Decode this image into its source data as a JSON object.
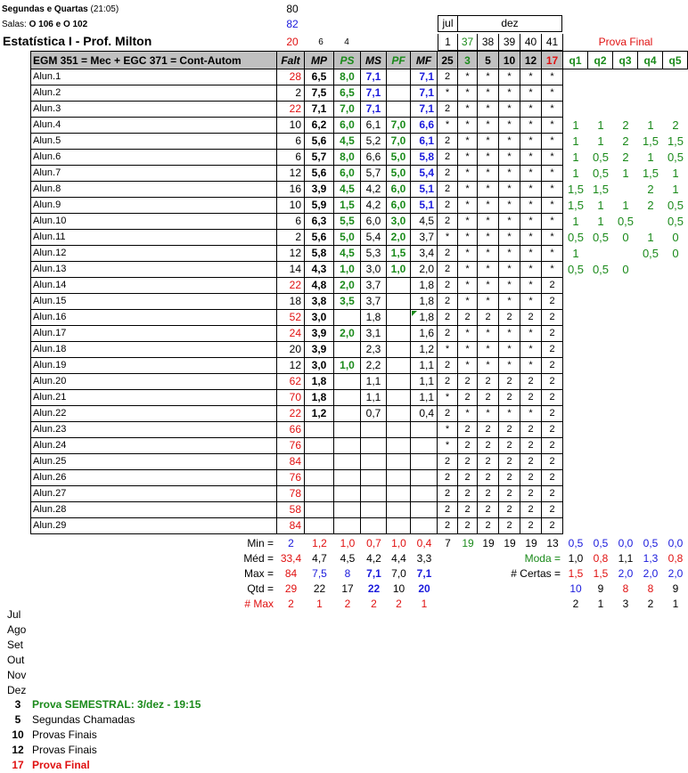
{
  "header": {
    "schedule_line": "Segundas e Quartas",
    "schedule_time": "(21:05)",
    "rooms_label": "Salas:",
    "rooms_value": "O 106 e O 102",
    "title": "Estatística I - Prof. Milton",
    "total_classes": "80",
    "classes_given": "82",
    "absence_limit": "20",
    "weight_mp": "6",
    "weight_ps": "4",
    "month_jul": "jul",
    "month_dez": "dez",
    "day_numbers": [
      "1",
      "37",
      "38",
      "39",
      "40",
      "41"
    ],
    "prova_final_label": "Prova Final",
    "course_label": "EGM 351 = Mec + EGC 371 = Cont-Autom",
    "columns": [
      "Falt",
      "MP",
      "PS",
      "MS",
      "PF",
      "MF",
      "25",
      "3",
      "5",
      "10",
      "12",
      "17",
      "q1",
      "q2",
      "q3",
      "q4",
      "q5"
    ]
  },
  "colors": {
    "red": "#e01010",
    "blue": "#1a1adc",
    "green": "#1a8a1a",
    "header_bg": "#c0c0c0"
  },
  "students": [
    [
      "Alun.1",
      "28",
      "6,5",
      "8,0",
      "7,1",
      "",
      "7,1",
      "2",
      "*",
      "*",
      "*",
      "*",
      "*",
      "",
      "",
      "",
      "",
      ""
    ],
    [
      "Alun.2",
      "2",
      "7,5",
      "6,5",
      "7,1",
      "",
      "7,1",
      "*",
      "*",
      "*",
      "*",
      "*",
      "*",
      "",
      "",
      "",
      "",
      ""
    ],
    [
      "Alun.3",
      "22",
      "7,1",
      "7,0",
      "7,1",
      "",
      "7,1",
      "2",
      "*",
      "*",
      "*",
      "*",
      "*",
      "",
      "",
      "",
      "",
      ""
    ],
    [
      "Alun.4",
      "10",
      "6,2",
      "6,0",
      "6,1",
      "7,0",
      "6,6",
      "*",
      "*",
      "*",
      "*",
      "*",
      "*",
      "1",
      "1",
      "2",
      "1",
      "2"
    ],
    [
      "Alun.5",
      "6",
      "5,6",
      "4,5",
      "5,2",
      "7,0",
      "6,1",
      "2",
      "*",
      "*",
      "*",
      "*",
      "*",
      "1",
      "1",
      "2",
      "1,5",
      "1,5"
    ],
    [
      "Alun.6",
      "6",
      "5,7",
      "8,0",
      "6,6",
      "5,0",
      "5,8",
      "2",
      "*",
      "*",
      "*",
      "*",
      "*",
      "1",
      "0,5",
      "2",
      "1",
      "0,5"
    ],
    [
      "Alun.7",
      "12",
      "5,6",
      "6,0",
      "5,7",
      "5,0",
      "5,4",
      "2",
      "*",
      "*",
      "*",
      "*",
      "*",
      "1",
      "0,5",
      "1",
      "1,5",
      "1"
    ],
    [
      "Alun.8",
      "16",
      "3,9",
      "4,5",
      "4,2",
      "6,0",
      "5,1",
      "2",
      "*",
      "*",
      "*",
      "*",
      "*",
      "1,5",
      "1,5",
      "",
      "2",
      "1"
    ],
    [
      "Alun.9",
      "10",
      "5,9",
      "1,5",
      "4,2",
      "6,0",
      "5,1",
      "2",
      "*",
      "*",
      "*",
      "*",
      "*",
      "1,5",
      "1",
      "1",
      "2",
      "0,5"
    ],
    [
      "Alun.10",
      "6",
      "6,3",
      "5,5",
      "6,0",
      "3,0",
      "4,5",
      "2",
      "*",
      "*",
      "*",
      "*",
      "*",
      "1",
      "1",
      "0,5",
      "",
      "0,5"
    ],
    [
      "Alun.11",
      "2",
      "5,6",
      "5,0",
      "5,4",
      "2,0",
      "3,7",
      "*",
      "*",
      "*",
      "*",
      "*",
      "*",
      "0,5",
      "0,5",
      "0",
      "1",
      "0"
    ],
    [
      "Alun.12",
      "12",
      "5,8",
      "4,5",
      "5,3",
      "1,5",
      "3,4",
      "2",
      "*",
      "*",
      "*",
      "*",
      "*",
      "1",
      "",
      "",
      "0,5",
      "0"
    ],
    [
      "Alun.13",
      "14",
      "4,3",
      "1,0",
      "3,0",
      "1,0",
      "2,0",
      "2",
      "*",
      "*",
      "*",
      "*",
      "*",
      "0,5",
      "0,5",
      "0",
      "",
      ""
    ],
    [
      "Alun.14",
      "22",
      "4,8",
      "2,0",
      "3,7",
      "",
      "1,8",
      "2",
      "*",
      "*",
      "*",
      "*",
      "2",
      "",
      "",
      "",
      "",
      ""
    ],
    [
      "Alun.15",
      "18",
      "3,8",
      "3,5",
      "3,7",
      "",
      "1,8",
      "2",
      "*",
      "*",
      "*",
      "*",
      "2",
      "",
      "",
      "",
      "",
      ""
    ],
    [
      "Alun.16",
      "52",
      "3,0",
      "",
      "1,8",
      "",
      "1,8",
      "2",
      "2",
      "2",
      "2",
      "2",
      "2",
      "",
      "",
      "",
      "",
      ""
    ],
    [
      "Alun.17",
      "24",
      "3,9",
      "2,0",
      "3,1",
      "",
      "1,6",
      "2",
      "*",
      "*",
      "*",
      "*",
      "2",
      "",
      "",
      "",
      "",
      ""
    ],
    [
      "Alun.18",
      "20",
      "3,9",
      "",
      "2,3",
      "",
      "1,2",
      "*",
      "*",
      "*",
      "*",
      "*",
      "2",
      "",
      "",
      "",
      "",
      ""
    ],
    [
      "Alun.19",
      "12",
      "3,0",
      "1,0",
      "2,2",
      "",
      "1,1",
      "2",
      "*",
      "*",
      "*",
      "*",
      "2",
      "",
      "",
      "",
      "",
      ""
    ],
    [
      "Alun.20",
      "62",
      "1,8",
      "",
      "1,1",
      "",
      "1,1",
      "2",
      "2",
      "2",
      "2",
      "2",
      "2",
      "",
      "",
      "",
      "",
      ""
    ],
    [
      "Alun.21",
      "70",
      "1,8",
      "",
      "1,1",
      "",
      "1,1",
      "*",
      "2",
      "2",
      "2",
      "2",
      "2",
      "",
      "",
      "",
      "",
      ""
    ],
    [
      "Alun.22",
      "22",
      "1,2",
      "",
      "0,7",
      "",
      "0,4",
      "2",
      "*",
      "*",
      "*",
      "*",
      "2",
      "",
      "",
      "",
      "",
      ""
    ],
    [
      "Alun.23",
      "66",
      "",
      "",
      "",
      "",
      "",
      "*",
      "2",
      "2",
      "2",
      "2",
      "2",
      "",
      "",
      "",
      "",
      ""
    ],
    [
      "Alun.24",
      "76",
      "",
      "",
      "",
      "",
      "",
      "*",
      "2",
      "2",
      "2",
      "2",
      "2",
      "",
      "",
      "",
      "",
      ""
    ],
    [
      "Alun.25",
      "84",
      "",
      "",
      "",
      "",
      "",
      "2",
      "2",
      "2",
      "2",
      "2",
      "2",
      "",
      "",
      "",
      "",
      ""
    ],
    [
      "Alun.26",
      "76",
      "",
      "",
      "",
      "",
      "",
      "2",
      "2",
      "2",
      "2",
      "2",
      "2",
      "",
      "",
      "",
      "",
      ""
    ],
    [
      "Alun.27",
      "78",
      "",
      "",
      "",
      "",
      "",
      "2",
      "2",
      "2",
      "2",
      "2",
      "2",
      "",
      "",
      "",
      "",
      ""
    ],
    [
      "Alun.28",
      "58",
      "",
      "",
      "",
      "",
      "",
      "2",
      "2",
      "2",
      "2",
      "2",
      "2",
      "",
      "",
      "",
      "",
      ""
    ],
    [
      "Alun.29",
      "84",
      "",
      "",
      "",
      "",
      "",
      "2",
      "2",
      "2",
      "2",
      "2",
      "2",
      "",
      "",
      "",
      "",
      ""
    ]
  ],
  "stats": {
    "min": {
      "label": "Min =",
      "values": [
        "2",
        "1,2",
        "1,0",
        "0,7",
        "1,0",
        "0,4"
      ],
      "day_values": [
        "7",
        "19",
        "19",
        "19",
        "19",
        "13"
      ],
      "q_values": [
        "0,5",
        "0,5",
        "0,0",
        "0,5",
        "0,0"
      ]
    },
    "med": {
      "label": "Méd =",
      "values": [
        "33,4",
        "4,7",
        "4,5",
        "4,2",
        "4,4",
        "3,3"
      ],
      "extra_label": "Moda =",
      "q_values": [
        "1,0",
        "0,8",
        "1,1",
        "1,3",
        "0,8"
      ]
    },
    "max": {
      "label": "Max =",
      "values": [
        "84",
        "7,5",
        "8",
        "7,1",
        "7,0",
        "7,1"
      ],
      "extra_label": "# Certas =",
      "q_values": [
        "1,5",
        "1,5",
        "2,0",
        "2,0",
        "2,0"
      ]
    },
    "qtd": {
      "label": "Qtd =",
      "values": [
        "29",
        "22",
        "17",
        "22",
        "10",
        "20"
      ],
      "q_values": [
        "10",
        "9",
        "8",
        "8",
        "9"
      ]
    },
    "nmax": {
      "label": "# Max",
      "values": [
        "2",
        "1",
        "2",
        "2",
        "2",
        "1"
      ],
      "q_values": [
        "2",
        "1",
        "3",
        "2",
        "1"
      ]
    }
  },
  "months": [
    "Jul",
    "Ago",
    "Set",
    "Out",
    "Nov",
    "Dez"
  ],
  "notes": [
    {
      "day": "3",
      "text": "Prova SEMESTRAL: 3/dez - 19:15"
    },
    {
      "day": "5",
      "text": "Segundas Chamadas"
    },
    {
      "day": "10",
      "text": "Provas Finais"
    },
    {
      "day": "12",
      "text": "Provas Finais"
    },
    {
      "day": "17",
      "text": "Prova Final"
    }
  ]
}
